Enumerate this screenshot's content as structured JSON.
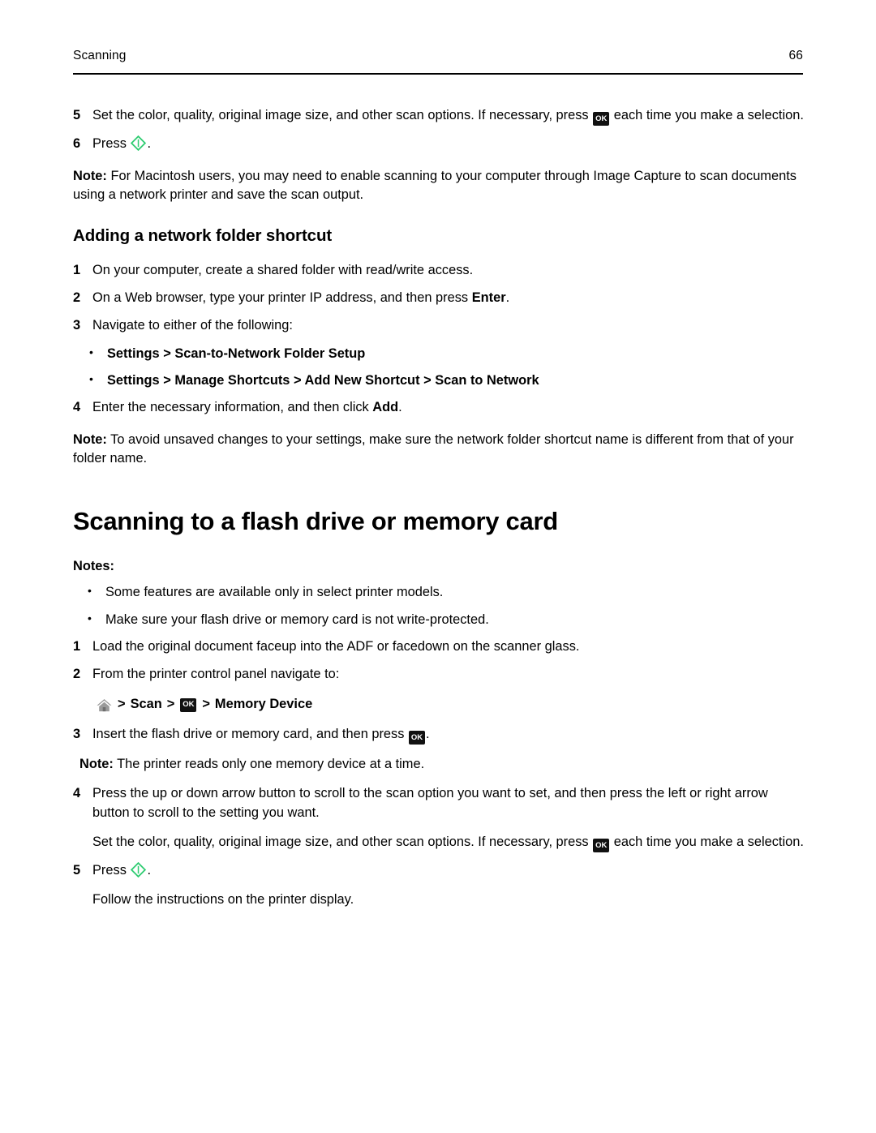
{
  "header": {
    "section": "Scanning",
    "page_number": "66"
  },
  "icons": {
    "ok_label": "OK",
    "ok_name": "ok-button-icon",
    "start_name": "start-button-icon",
    "home_name": "home-button-icon",
    "start_color": "#2ECC71",
    "home_color": "#9A9A9A"
  },
  "steps_top": {
    "step5": {
      "num": "5",
      "text_before": "Set the color, quality, original image size, and other scan options. If necessary, press ",
      "text_after": " each time you make a selection."
    },
    "step6": {
      "num": "6",
      "text_before": "Press ",
      "text_after": "."
    }
  },
  "note_macintosh": {
    "label": "Note:",
    "text": " For Macintosh users, you may need to enable scanning to your computer through Image Capture to scan documents using a network printer and save the scan output."
  },
  "section_network_folder": {
    "heading": "Adding a network folder shortcut",
    "steps": [
      {
        "num": "1",
        "text": "On your computer, create a shared folder with read/write access."
      },
      {
        "num": "2",
        "text_before": "On a Web browser, type your printer IP address, and then press ",
        "bold": "Enter",
        "text_after": "."
      },
      {
        "num": "3",
        "text": "Navigate to either of the following:"
      },
      {
        "num": "4",
        "text_before": "Enter the necessary information, and then click ",
        "bold": "Add",
        "text_after": "."
      }
    ],
    "bullets": [
      "Settings > Scan-to-Network Folder Setup",
      "Settings > Manage Shortcuts > Add New Shortcut > Scan to Network"
    ]
  },
  "note_unsaved": {
    "label": "Note:",
    "text": " To avoid unsaved changes to your settings, make sure the network folder shortcut name is different from that of your folder name."
  },
  "section_flash_drive": {
    "heading": "Scanning to a flash drive or memory card",
    "notes_label": "Notes:",
    "notes": [
      "Some features are available only in select printer models.",
      "Make sure your flash drive or memory card is not write-protected."
    ],
    "step1": {
      "num": "1",
      "text": "Load the original document faceup into the ADF or facedown on the scanner glass."
    },
    "step2": {
      "num": "2",
      "text": "From the printer control panel navigate to:"
    },
    "nav_path": {
      "sep1": ">",
      "scan": "Scan",
      "sep2": ">",
      "sep3": ">",
      "memory_device": "Memory Device"
    },
    "step3": {
      "num": "3",
      "text_before": "Insert the flash drive or memory card, and then press ",
      "text_after": "."
    },
    "step3_note": {
      "label": "Note:",
      "text": " The printer reads only one memory device at a time."
    },
    "step4": {
      "num": "4",
      "text": "Press the up or down arrow button to scroll to the scan option you want to set, and then press the left or right arrow button to scroll to the setting you want."
    },
    "step4_continued": {
      "text_before": "Set the color, quality, original image size, and other scan options. If necessary, press ",
      "text_after": " each time you make a selection."
    },
    "step5": {
      "num": "5",
      "text_before": "Press ",
      "text_after": "."
    },
    "step5_continued": "Follow the instructions on the printer display."
  }
}
